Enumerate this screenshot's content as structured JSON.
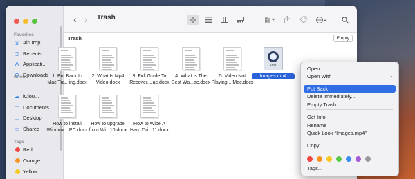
{
  "window": {
    "title": "Trash",
    "path_label": "Trash",
    "empty_button": "Empty"
  },
  "sidebar": {
    "favorites_header": "Favorites",
    "favorites": [
      {
        "label": "AirDrop",
        "icon": "airdrop-icon",
        "glyph": "◎"
      },
      {
        "label": "Recents",
        "icon": "clock-icon",
        "glyph": "◷"
      },
      {
        "label": "Applicati...",
        "icon": "applications-icon",
        "glyph": "A"
      },
      {
        "label": "Downloads",
        "icon": "download-icon",
        "glyph": "⊕"
      }
    ],
    "icloud_header": "iCloud",
    "icloud": [
      {
        "label": "iClou...",
        "icon": "cloud-icon",
        "glyph": "☁"
      },
      {
        "label": "Documents",
        "icon": "document-icon",
        "glyph": "▭"
      },
      {
        "label": "Desktop",
        "icon": "desktop-icon",
        "glyph": "▭"
      },
      {
        "label": "Shared",
        "icon": "shared-folder-icon",
        "glyph": "▭"
      }
    ],
    "tags_header": "Tags",
    "tags": [
      {
        "label": "Red",
        "color": "#f2473f"
      },
      {
        "label": "Orange",
        "color": "#f7931e"
      },
      {
        "label": "Yellow",
        "color": "#f7c81e"
      }
    ]
  },
  "toolbar": {
    "back": "‹",
    "forward": "›"
  },
  "files": [
    {
      "line1": "1. Put Back In",
      "line2": "Mac Tra...ing.docx"
    },
    {
      "line1": "2. What Is Mp4",
      "line2": "Video.docx"
    },
    {
      "line1": "3. Full Guide To",
      "line2": "Recover....ac.docx"
    },
    {
      "line1": "4. What Is The",
      "line2": "Best Wa...ac.docx"
    },
    {
      "line1": "5. Video Not",
      "line2": "Playing....Mac.docx"
    },
    {
      "line1": "Images.mp4",
      "line2": "",
      "video_label": "MP4"
    },
    {
      "line1": "How to install",
      "line2": "Window....PC.docx"
    },
    {
      "line1": "How to upgrade",
      "line2": "from Wi...10.docx"
    },
    {
      "line1": "How to Wipe A",
      "line2": "Hard Dri...11.docx"
    }
  ],
  "context_menu": {
    "items": [
      "Open",
      "Open With",
      "Put Back",
      "Delete Immediately...",
      "Empty Trash",
      "Get Info",
      "Rename",
      "Quick Look “Images.mp4”",
      "Copy",
      "Tags..."
    ],
    "highlighted": "Put Back",
    "tag_colors": [
      "#f2473f",
      "#f7931e",
      "#f7c81e",
      "#5ac94a",
      "#3a8cf0",
      "#a55bd6",
      "#9a9a9e"
    ]
  }
}
